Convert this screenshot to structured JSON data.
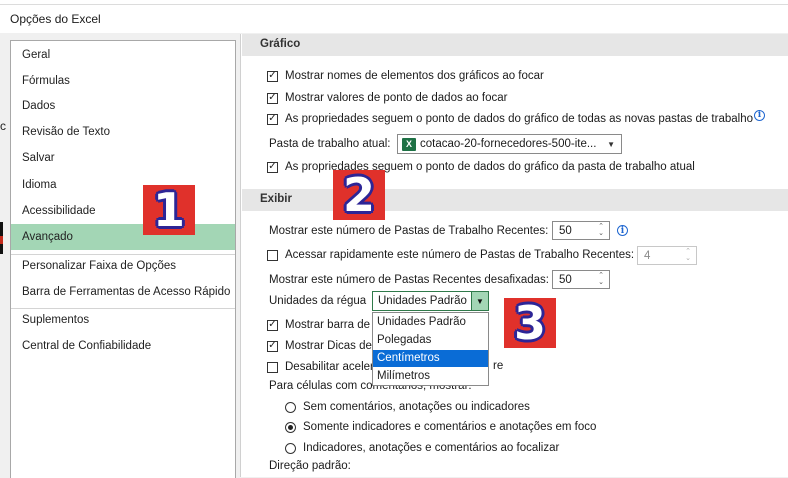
{
  "window": {
    "title": "Opções do Excel"
  },
  "sidebar": {
    "items": [
      {
        "label": "Geral"
      },
      {
        "label": "Fórmulas"
      },
      {
        "label": "Dados"
      },
      {
        "label": "Revisão de Texto"
      },
      {
        "label": "Salvar"
      },
      {
        "label": "Idioma"
      },
      {
        "label": "Acessibilidade"
      },
      {
        "label": "Avançado",
        "selected": true
      },
      {
        "label": "Personalizar Faixa de Opções"
      },
      {
        "label": "Barra de Ferramentas de Acesso Rápido"
      },
      {
        "label": "Suplementos"
      },
      {
        "label": "Central de Confiabilidade"
      }
    ]
  },
  "grafico": {
    "header": "Gráfico",
    "show_names": {
      "label": "Mostrar nomes de elementos dos gráficos ao focar",
      "checked": true
    },
    "show_values": {
      "label": "Mostrar valores de ponto de dados ao focar",
      "checked": true
    },
    "props_new": {
      "label": "As propriedades seguem o ponto de dados do gráfico de todas as novas pastas de trabalho",
      "checked": true
    },
    "workbook_label": "Pasta de trabalho atual:",
    "workbook_value": "cotacao-20-fornecedores-500-ite...",
    "props_current": {
      "label": "As propriedades seguem o ponto de dados do gráfico da pasta de trabalho atual",
      "checked": true
    }
  },
  "exibir": {
    "header": "Exibir",
    "recent_label": "Mostrar este número de Pastas de Trabalho Recentes:",
    "recent_value": "50",
    "quick_access": {
      "label": "Acessar rapidamente este número de Pastas de Trabalho Recentes:",
      "checked": false,
      "value": "4"
    },
    "unpinned_label": "Mostrar este número de Pastas Recentes desafixadas:",
    "unpinned_value": "50",
    "ruler_label": "Unidades da régua",
    "ruler_value": "Unidades Padrão",
    "ruler_options": [
      "Unidades Padrão",
      "Polegadas",
      "Centímetros",
      "Milímetros"
    ],
    "ruler_highlight": "Centímetros",
    "formula_bar": {
      "label": "Mostrar barra de",
      "checked": true
    },
    "tooltips": {
      "label": "Mostrar Dicas de",
      "checked": true
    },
    "hw_accel": {
      "label": "Desabilitar aceler",
      "label_tail": "re",
      "checked": false
    },
    "comments_label": "Para células com comentários, mostrar:",
    "radio_none": {
      "label": "Sem comentários, anotações ou indicadores",
      "selected": false
    },
    "radio_indicators": {
      "label": "Somente indicadores e comentários e anotações em foco",
      "selected": true
    },
    "radio_all": {
      "label": "Indicadores, anotações e comentários ao focalizar",
      "selected": false
    },
    "direction_label": "Direção padrão:"
  },
  "callouts": [
    "1",
    "2",
    "3"
  ],
  "colors": {
    "selected": "#a3d6b5",
    "highlight": "#0a6cd6",
    "badge": "#e0312b",
    "badge_text_outline": "#2d2596",
    "excel_green": "#1e7145"
  },
  "icons": {
    "info": "info-circle-icon",
    "excel_file": "excel-file-icon",
    "dropdown": "chevron-down-icon"
  }
}
